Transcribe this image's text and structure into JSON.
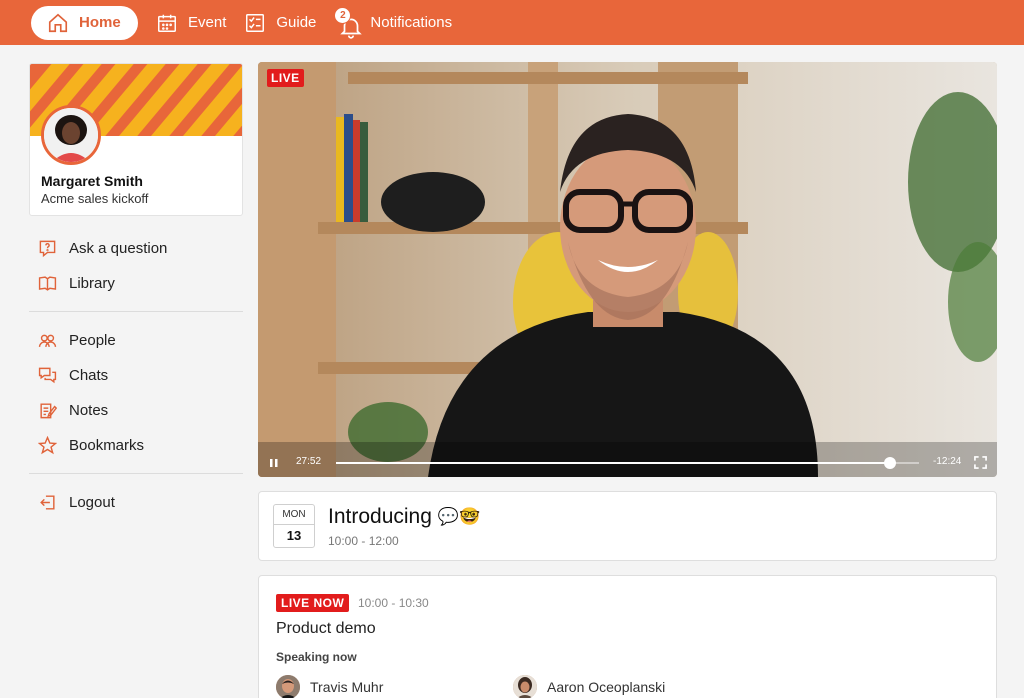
{
  "nav": {
    "items": [
      {
        "label": "Home",
        "icon": "home-icon",
        "active": true
      },
      {
        "label": "Event",
        "icon": "calendar-icon"
      },
      {
        "label": "Guide",
        "icon": "checklist-icon"
      },
      {
        "label": "Notifications",
        "icon": "bell-icon",
        "badge": "2"
      }
    ]
  },
  "profile": {
    "name": "Margaret Smith",
    "event": "Acme sales kickoff"
  },
  "sidebar": {
    "group1": [
      {
        "label": "Ask a question",
        "icon": "question-icon"
      },
      {
        "label": "Library",
        "icon": "book-icon"
      }
    ],
    "group2": [
      {
        "label": "People",
        "icon": "people-icon"
      },
      {
        "label": "Chats",
        "icon": "chat-icon"
      },
      {
        "label": "Notes",
        "icon": "notes-icon"
      },
      {
        "label": "Bookmarks",
        "icon": "star-icon"
      }
    ],
    "group3": [
      {
        "label": "Logout",
        "icon": "logout-icon"
      }
    ]
  },
  "video": {
    "live_label": "LIVE",
    "elapsed": "27:52",
    "remaining": "-12:24",
    "progress": 0.95
  },
  "session": {
    "month": "MON",
    "day": "13",
    "title": "Introducing",
    "emoji": "💬🤓",
    "time": "10:00 - 12:00"
  },
  "agenda": {
    "live_label": "LIVE NOW",
    "time": "10:00 - 10:30",
    "title": "Product demo",
    "speaking_label": "Speaking now",
    "speakers": [
      {
        "name": "Travis Muhr"
      },
      {
        "name": "Aaron Oceoplanski"
      }
    ]
  },
  "colors": {
    "brand": "#e8663a",
    "accent": "#f6b21e",
    "live": "#e21c1c"
  }
}
